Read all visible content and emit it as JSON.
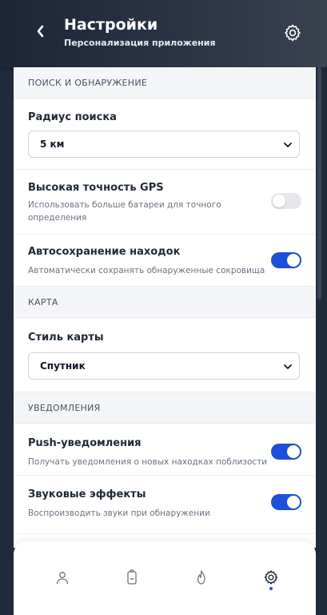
{
  "header": {
    "title": "Настройки",
    "subtitle": "Персонализация приложения",
    "back_icon": "chevron-left-icon",
    "settings_icon": "gear-icon"
  },
  "sections": {
    "search": {
      "title": "ПОИСК И ОБНАРУЖЕНИЕ",
      "radius_label": "Радиус поиска",
      "radius_value": "5 км",
      "gps_label": "Высокая точность GPS",
      "gps_desc_line1": "Использовать больше батареи для точного",
      "gps_desc_line2": "определения",
      "gps_enabled": false,
      "autosave_label": "Автосохранение находок",
      "autosave_desc": "Автоматически сохранять обнаруженные сокровища",
      "autosave_enabled": true
    },
    "map": {
      "title": "КАРТА",
      "style_label": "Стиль карты",
      "style_value": "Спутник"
    },
    "notifications": {
      "title": "УВЕДОМЛЕНИЯ",
      "push_label": "Push-уведомления",
      "push_desc": "Получать уведомления о новых находках поблизости",
      "push_enabled": true,
      "sound_label": "Звуковые эффекты",
      "sound_desc": "Воспроизводить звуки при обнаружении",
      "sound_enabled": true
    }
  },
  "bottom_nav": {
    "items": [
      {
        "icon": "user-icon",
        "active": false
      },
      {
        "icon": "battery-icon",
        "active": false
      },
      {
        "icon": "flame-icon",
        "active": false
      },
      {
        "icon": "gear-icon",
        "active": true
      }
    ]
  },
  "colors": {
    "accent": "#1e4fd8",
    "header_dark": "#1d2636",
    "section_bg": "#f4f5f7",
    "toggle_off": "#e5e7eb"
  }
}
